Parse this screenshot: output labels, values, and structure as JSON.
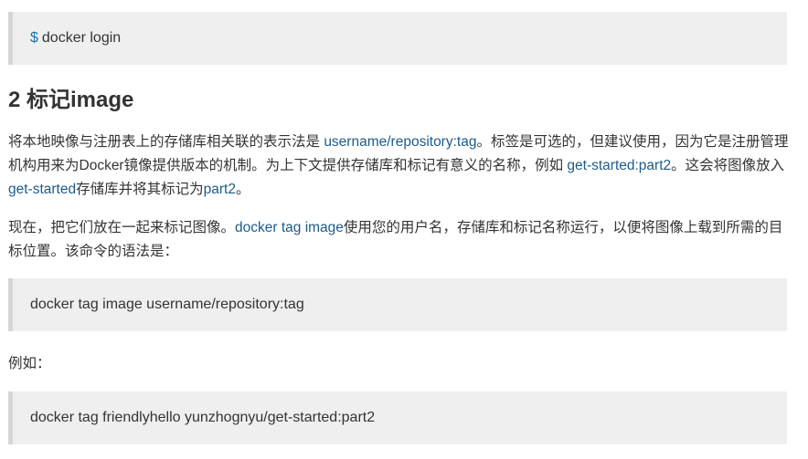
{
  "code1": {
    "prompt": "$",
    "command": "docker login"
  },
  "heading": "2 标记image",
  "para1": {
    "t1": "将本地映像与注册表上的存储库相关联的表示法是 ",
    "link1": "username/repository:tag",
    "t2": "。标签是可选的，但建议使用，因为它是注册管理机构用来为Docker镜像提供版本的机制。为上下文提供存储库和标记有意义的名称，例如 ",
    "link2": "get-started:part2",
    "t3": "。这会将图像放入",
    "link3": "get-started",
    "t4": "存储库并将其标记为",
    "link4": "part2",
    "t5": "。"
  },
  "para2": {
    "t1": "现在，把它们放在一起来标记图像。",
    "link1": "docker tag image",
    "t2": "使用您的用户名，存储库和标记名称运行，以便将图像上载到所需的目标位置。该命令的语法是："
  },
  "code2": {
    "command": "docker tag image username/repository:tag"
  },
  "para3": {
    "text": "例如："
  },
  "code3": {
    "command": "docker tag friendlyhello yunzhognyu/get-started:part2"
  }
}
